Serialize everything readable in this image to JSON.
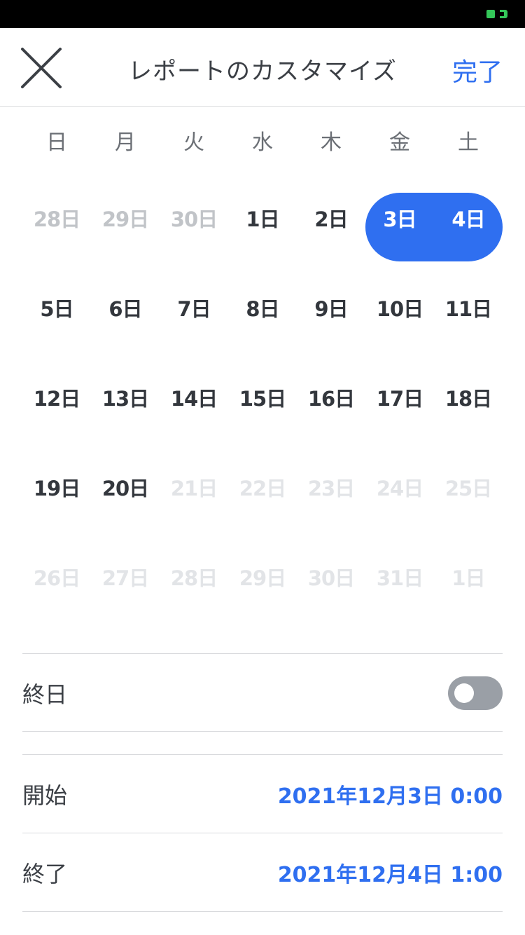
{
  "header": {
    "title": "レポートのカスタマイズ",
    "done_label": "完了"
  },
  "calendar": {
    "weekdays": [
      "日",
      "月",
      "火",
      "水",
      "木",
      "金",
      "土"
    ],
    "weeks": [
      [
        {
          "label": "28日",
          "state": "muted"
        },
        {
          "label": "29日",
          "state": "muted"
        },
        {
          "label": "30日",
          "state": "muted"
        },
        {
          "label": "1日",
          "state": "normal"
        },
        {
          "label": "2日",
          "state": "normal"
        },
        {
          "label": "3日",
          "state": "selected"
        },
        {
          "label": "4日",
          "state": "selected"
        }
      ],
      [
        {
          "label": "5日",
          "state": "normal"
        },
        {
          "label": "6日",
          "state": "normal"
        },
        {
          "label": "7日",
          "state": "normal"
        },
        {
          "label": "8日",
          "state": "normal"
        },
        {
          "label": "9日",
          "state": "normal"
        },
        {
          "label": "10日",
          "state": "normal"
        },
        {
          "label": "11日",
          "state": "normal"
        }
      ],
      [
        {
          "label": "12日",
          "state": "normal"
        },
        {
          "label": "13日",
          "state": "normal"
        },
        {
          "label": "14日",
          "state": "normal"
        },
        {
          "label": "15日",
          "state": "normal"
        },
        {
          "label": "16日",
          "state": "normal"
        },
        {
          "label": "17日",
          "state": "normal"
        },
        {
          "label": "18日",
          "state": "normal"
        }
      ],
      [
        {
          "label": "19日",
          "state": "normal"
        },
        {
          "label": "20日",
          "state": "normal"
        },
        {
          "label": "21日",
          "state": "disabled"
        },
        {
          "label": "22日",
          "state": "disabled"
        },
        {
          "label": "23日",
          "state": "disabled"
        },
        {
          "label": "24日",
          "state": "disabled"
        },
        {
          "label": "25日",
          "state": "disabled"
        }
      ],
      [
        {
          "label": "26日",
          "state": "disabled"
        },
        {
          "label": "27日",
          "state": "disabled"
        },
        {
          "label": "28日",
          "state": "disabled"
        },
        {
          "label": "29日",
          "state": "disabled"
        },
        {
          "label": "30日",
          "state": "disabled"
        },
        {
          "label": "31日",
          "state": "disabled"
        },
        {
          "label": "1日",
          "state": "disabled"
        }
      ]
    ]
  },
  "all_day": {
    "label": "終日",
    "enabled": false
  },
  "start": {
    "label": "開始",
    "value": "2021年12月3日 0:00"
  },
  "end": {
    "label": "終了",
    "value": "2021年12月4日 1:00"
  },
  "colors": {
    "accent": "#2f6ff0",
    "toggle_off": "#9a9fa6",
    "battery": "#34c759"
  }
}
